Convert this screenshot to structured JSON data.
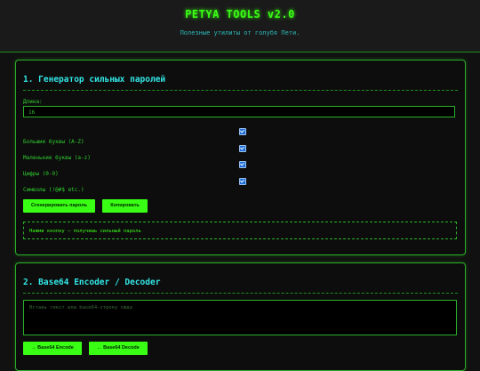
{
  "header": {
    "title": "PETYA TOOLS v2.0",
    "subtitle": "Полезные утилиты от голубя Пети."
  },
  "password_generator": {
    "title": "1. Генератор сильных паролей",
    "length_label": "Длина:",
    "length_value": "16",
    "options": [
      {
        "label": "Большие буквы (A-Z)",
        "checked": true
      },
      {
        "label": "Маленькие буквы (a-z)",
        "checked": true
      },
      {
        "label": "Цифры (0-9)",
        "checked": true
      },
      {
        "label": "Символы (!@#$ etc.)",
        "checked": true
      }
    ],
    "generate_label": "Сгенерировать пароль",
    "copy_label": "Копировать",
    "output_text": "Нажми кнопку — получишь сильный пароль"
  },
  "base64": {
    "title": "2. Base64 Encoder / Decoder",
    "input_placeholder": "Вставь текст или base64-строку сюда",
    "encode_label": "→ Base64 Encode",
    "decode_label": "← Base64 Decode"
  },
  "colors": {
    "accent": "#39ff14",
    "title_cyan": "#33e6e6",
    "background": "#111111"
  }
}
